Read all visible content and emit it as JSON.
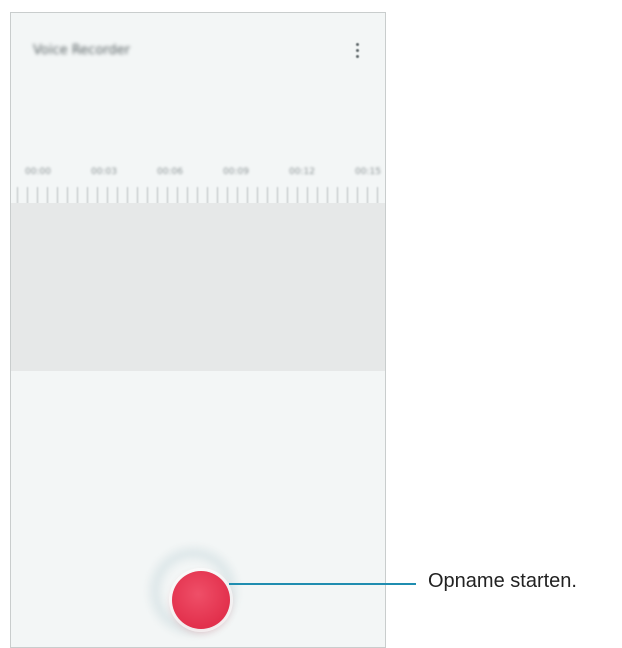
{
  "app": {
    "title": "Voice Recorder",
    "more_icon": "more-vertical-icon"
  },
  "timeline": {
    "labels": [
      "00:00",
      "00:03",
      "00:06",
      "00:09",
      "00:12",
      "00:15"
    ]
  },
  "record": {
    "icon": "record-icon",
    "color": "#e8334f"
  },
  "callout": {
    "text": "Opname starten.",
    "line_color": "#1f8db0"
  }
}
